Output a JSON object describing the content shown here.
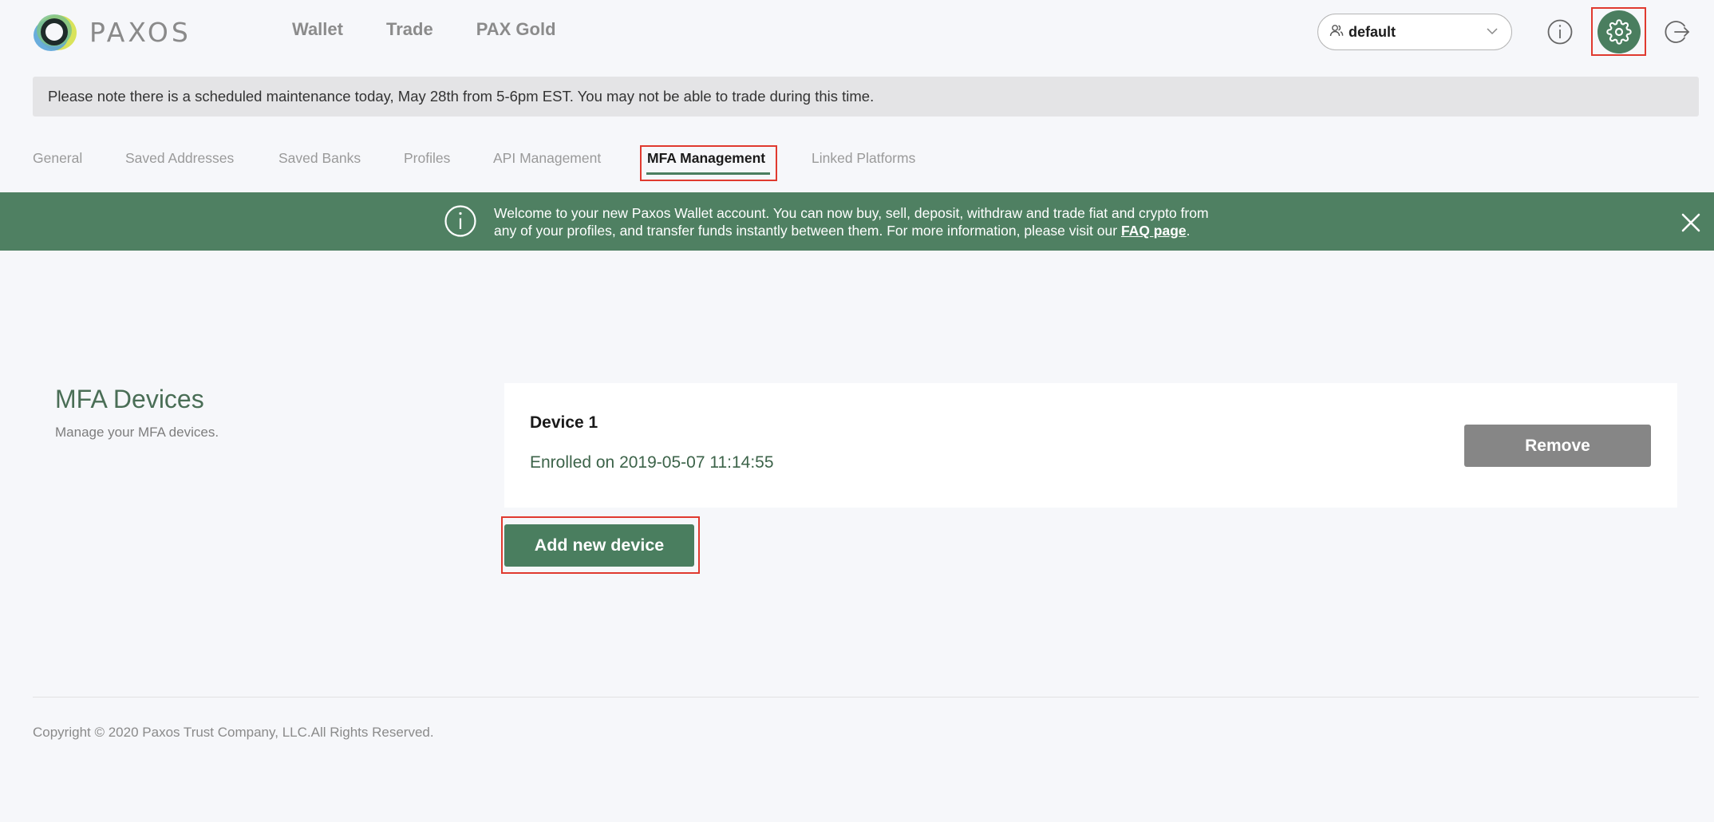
{
  "brand": {
    "name": "PAXOS"
  },
  "nav": {
    "wallet": "Wallet",
    "trade": "Trade",
    "pax_gold": "PAX Gold"
  },
  "profile_select": {
    "value": "default"
  },
  "notice": {
    "text": "Please note there is a scheduled maintenance today, May 28th from 5-6pm EST. You may not be able to trade during this time."
  },
  "tabs": [
    {
      "label": "General"
    },
    {
      "label": "Saved Addresses"
    },
    {
      "label": "Saved Banks"
    },
    {
      "label": "Profiles"
    },
    {
      "label": "API Management"
    },
    {
      "label": "MFA Management",
      "active": true
    },
    {
      "label": "Linked Platforms"
    }
  ],
  "welcome": {
    "line1": "Welcome to your new Paxos Wallet account. You can now buy, sell, deposit, withdraw and trade fiat and crypto from",
    "line2_prefix": "any of your profiles, and transfer funds instantly between them. For more information, please visit our",
    "link_text": "FAQ page",
    "line2_suffix": "."
  },
  "mfa": {
    "title": "MFA Devices",
    "subtitle": "Manage your MFA devices.",
    "device": {
      "name": "Device 1",
      "enrolled": "Enrolled on 2019-05-07 11:14:55"
    },
    "remove_label": "Remove",
    "add_label": "Add new device"
  },
  "footer": {
    "copyright": "Copyright © 2020 Paxos Trust Company, LLC.All Rights Reserved."
  },
  "colors": {
    "brand_green": "#4a7e5f",
    "banner_green": "#4f8062",
    "highlight_red": "#e03a2f"
  }
}
